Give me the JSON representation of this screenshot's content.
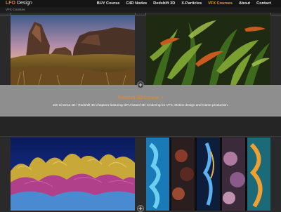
{
  "brand": {
    "mark": "LFO",
    "name": "Design"
  },
  "nav": [
    {
      "label": "BUY Course",
      "active": false
    },
    {
      "label": "C4D Nodes",
      "active": false
    },
    {
      "label": "Redshift 3D",
      "active": false
    },
    {
      "label": "X-Particles",
      "active": false
    },
    {
      "label": "VFX Courses",
      "active": true
    },
    {
      "label": "About",
      "active": false
    },
    {
      "label": "Contact",
      "active": false
    }
  ],
  "breadcrumb": "VFX Courses",
  "feature": {
    "title": "Redshift 3D Course >",
    "description": "150 Cinema 4D / Redshift 3D chapters featuring GPU based 3D rendering for VFX, Motion design and Game production."
  },
  "colors": {
    "accent": "#f08a1e",
    "nav_active": "#f0a020"
  }
}
